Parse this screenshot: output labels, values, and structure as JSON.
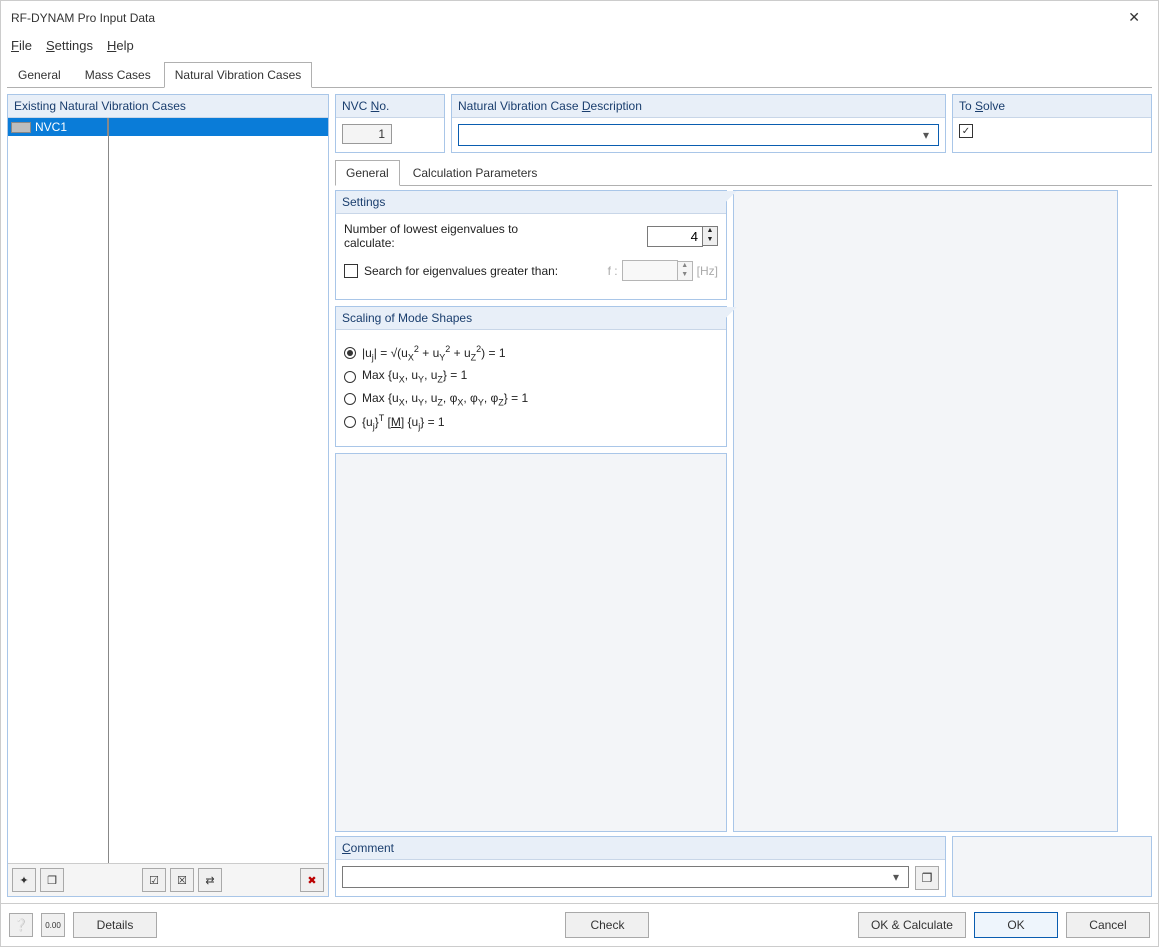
{
  "window": {
    "title": "RF-DYNAM Pro Input Data"
  },
  "menu": {
    "file": "File",
    "settings": "Settings",
    "help": "Help"
  },
  "outerTabs": {
    "general": "General",
    "massCases": "Mass Cases",
    "nvc": "Natural Vibration Cases"
  },
  "leftPanel": {
    "title": "Existing Natural Vibration Cases",
    "items": [
      {
        "label": "NVC1"
      }
    ]
  },
  "nvcNo": {
    "label": "NVC No.",
    "value": "1"
  },
  "nvcDesc": {
    "label": "Natural Vibration Case Description",
    "value": ""
  },
  "toSolve": {
    "label": "To Solve",
    "checked": true
  },
  "innerTabs": {
    "general": "General",
    "calcParams": "Calculation Parameters"
  },
  "settingsPanel": {
    "title": "Settings",
    "eigenLabel": "Number of lowest eigenvalues to calculate:",
    "eigenValue": "4",
    "searchLabel": "Search for eigenvalues greater than:",
    "fLabel": "f :",
    "fUnit": "[Hz]"
  },
  "scalingPanel": {
    "title": "Scaling of Mode Shapes",
    "opt1_pre": "|u",
    "opt1_mid": "| = √(u",
    "opt1_mid2": " + u",
    "opt1_mid3": " + u",
    "opt1_end": ") = 1",
    "opt2": "Max {uX, uY, uZ} = 1",
    "opt3": "Max {uX, uY, uZ, φX, φY, φZ} = 1",
    "opt4_pre": "{u",
    "opt4_mid": "}",
    "opt4_m": " [M] ",
    "opt4_mid2": "{u",
    "opt4_end": "} = 1"
  },
  "comment": {
    "title": "Comment",
    "value": ""
  },
  "footer": {
    "details": "Details",
    "check": "Check",
    "okCalc": "OK & Calculate",
    "ok": "OK",
    "cancel": "Cancel"
  }
}
